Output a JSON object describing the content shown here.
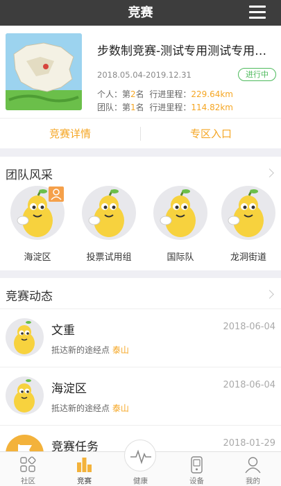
{
  "header": {
    "title": "竞赛"
  },
  "competition": {
    "title": "步数制竞赛-测试专用测试专用测试专用",
    "dates": "2018.05.04-2019.12.31",
    "status": "进行中",
    "personal": {
      "label": "个人：",
      "rank_prefix": "第",
      "rank": "2",
      "rank_suffix": "名",
      "progress_label": "行进里程：",
      "distance": "229.64km"
    },
    "team": {
      "label": "团队：",
      "rank_prefix": "第",
      "rank": "1",
      "rank_suffix": "名",
      "progress_label": "行进里程：",
      "distance": "114.82km"
    }
  },
  "actions": {
    "details": "竞赛详情",
    "zone": "专区入口"
  },
  "teams": {
    "title": "团队风采",
    "items": [
      {
        "name": "海淀区"
      },
      {
        "name": "投票试用组"
      },
      {
        "name": "国际队"
      },
      {
        "name": "龙洞街道"
      }
    ]
  },
  "news": {
    "title": "竞赛动态",
    "items": [
      {
        "name": "文重",
        "date": "2018-06-04",
        "desc": "抵达新的途经点",
        "place": "泰山"
      },
      {
        "name": "海淀区",
        "date": "2018-06-04",
        "desc": "抵达新的途经点",
        "place": "泰山"
      },
      {
        "name": "竞赛任务",
        "date": "2018-01-29"
      }
    ]
  },
  "tabbar": {
    "items": [
      {
        "label": "社区",
        "icon": "community-icon"
      },
      {
        "label": "竞赛",
        "icon": "competition-icon"
      },
      {
        "label": "健康",
        "icon": "health-icon"
      },
      {
        "label": "设备",
        "icon": "device-icon"
      },
      {
        "label": "我的",
        "icon": "profile-icon"
      }
    ]
  },
  "colors": {
    "accent": "#f5a623",
    "status_green": "#4cba5b",
    "topbar": "#3d3d3d"
  }
}
